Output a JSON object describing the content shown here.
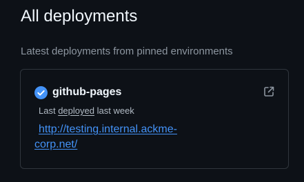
{
  "header": {
    "title": "All deployments",
    "subtitle": "Latest deployments from pinned environments"
  },
  "deployment": {
    "environment_name": "github-pages",
    "status_icon": "check-circle-fill-icon",
    "status_color": "#4493f8",
    "meta_prefix": "Last",
    "meta_link": "deployed",
    "meta_suffix": "last week",
    "url_line1": "http://testing.internal.ackme-",
    "url_line2": "corp.net/",
    "external_link_icon": "link-external-icon"
  }
}
